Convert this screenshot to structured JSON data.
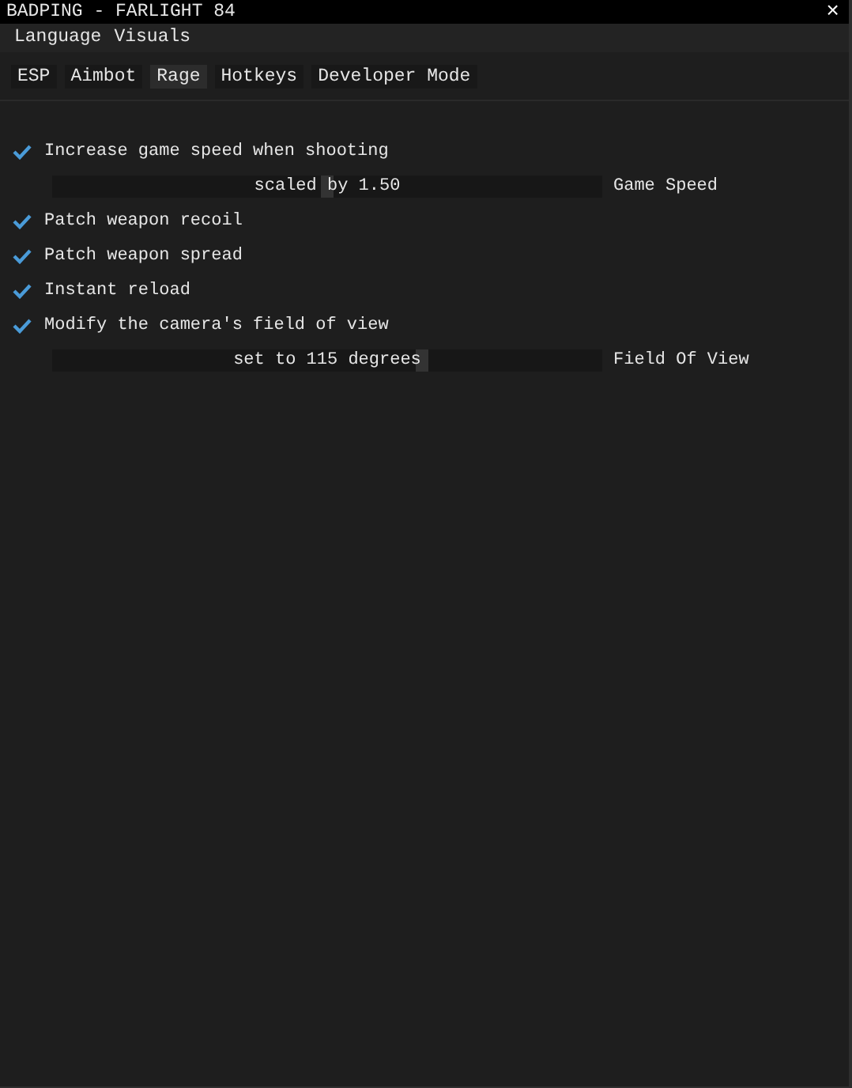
{
  "window": {
    "title": "BADPING - FARLIGHT 84",
    "close": "×"
  },
  "menu": [
    "Language",
    "Visuals"
  ],
  "tabs": [
    {
      "label": "ESP",
      "selected": false
    },
    {
      "label": "Aimbot",
      "selected": false
    },
    {
      "label": "Rage",
      "selected": true
    },
    {
      "label": "Hotkeys",
      "selected": false
    },
    {
      "label": "Developer Mode",
      "selected": false
    }
  ],
  "options": [
    {
      "label": "Increase game speed when shooting",
      "checked": true,
      "slider": {
        "value": "scaled by 1.50",
        "label": "Game Speed",
        "level": 0.5
      }
    },
    {
      "label": "Patch weapon recoil",
      "checked": true
    },
    {
      "label": "Patch weapon spread",
      "checked": true
    },
    {
      "label": "Instant reload",
      "checked": true
    },
    {
      "label": "Modify the camera's field of view",
      "checked": true,
      "slider": {
        "value": "set to 115 degrees",
        "label": "Field Of View",
        "level": 0.675
      }
    }
  ]
}
